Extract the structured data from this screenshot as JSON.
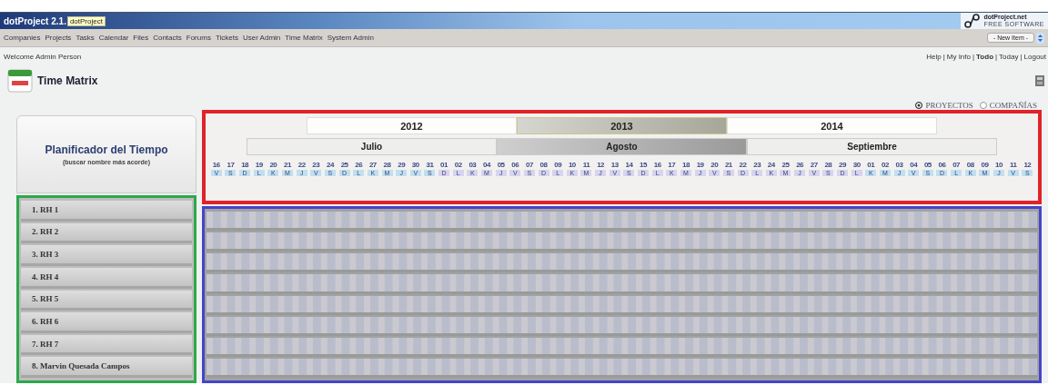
{
  "header": {
    "title": "dotProject 2.1.",
    "tooltip": "dotProject",
    "logo": {
      "name": "dotProject.net",
      "tagline": "FREE SOFTWARE"
    }
  },
  "menu": [
    "Companies",
    "Projects",
    "Tasks",
    "Calendar",
    "Files",
    "Contacts",
    "Forums",
    "Tickets",
    "User Admin",
    "Time Matrix",
    "System Admin"
  ],
  "new_item": "- New Item -",
  "welcome": "Welcome Admin Person",
  "link_separator": "|",
  "user_links": [
    {
      "label": "Help",
      "bold": false
    },
    {
      "label": "My Info",
      "bold": false
    },
    {
      "label": "Todo",
      "bold": true
    },
    {
      "label": "Today",
      "bold": false
    },
    {
      "label": "Logout",
      "bold": false
    }
  ],
  "page_title": "Time Matrix",
  "view_options": [
    {
      "label": "PROYECTOS",
      "selected": true
    },
    {
      "label": "COMPAÑÍAS",
      "selected": false
    }
  ],
  "planner": {
    "title": "Planificador del Tiempo",
    "subtitle": "(buscar nombre más acorde)"
  },
  "years": [
    {
      "label": "2012",
      "selected": false
    },
    {
      "label": "2013",
      "selected": true
    },
    {
      "label": "2014",
      "selected": false
    }
  ],
  "months": [
    {
      "label": "Julio",
      "selected": false,
      "days": [
        {
          "day": "16",
          "weekday": "V"
        },
        {
          "day": "17",
          "weekday": "S"
        },
        {
          "day": "18",
          "weekday": "D"
        },
        {
          "day": "19",
          "weekday": "L"
        },
        {
          "day": "20",
          "weekday": "K"
        },
        {
          "day": "21",
          "weekday": "M"
        },
        {
          "day": "22",
          "weekday": "J"
        },
        {
          "day": "23",
          "weekday": "V"
        },
        {
          "day": "24",
          "weekday": "S"
        },
        {
          "day": "25",
          "weekday": "D"
        },
        {
          "day": "26",
          "weekday": "L"
        },
        {
          "day": "27",
          "weekday": "K"
        },
        {
          "day": "28",
          "weekday": "M"
        },
        {
          "day": "29",
          "weekday": "J"
        },
        {
          "day": "30",
          "weekday": "V"
        },
        {
          "day": "31",
          "weekday": "S"
        }
      ]
    },
    {
      "label": "Agosto",
      "selected": true,
      "days": [
        {
          "day": "01",
          "weekday": "D"
        },
        {
          "day": "02",
          "weekday": "L"
        },
        {
          "day": "03",
          "weekday": "K"
        },
        {
          "day": "04",
          "weekday": "M"
        },
        {
          "day": "05",
          "weekday": "J"
        },
        {
          "day": "06",
          "weekday": "V"
        },
        {
          "day": "07",
          "weekday": "S"
        },
        {
          "day": "08",
          "weekday": "D"
        },
        {
          "day": "09",
          "weekday": "L"
        },
        {
          "day": "10",
          "weekday": "K"
        },
        {
          "day": "11",
          "weekday": "M"
        },
        {
          "day": "12",
          "weekday": "J"
        },
        {
          "day": "13",
          "weekday": "V"
        },
        {
          "day": "14",
          "weekday": "S"
        },
        {
          "day": "15",
          "weekday": "D"
        },
        {
          "day": "16",
          "weekday": "L"
        },
        {
          "day": "17",
          "weekday": "K"
        },
        {
          "day": "18",
          "weekday": "M"
        },
        {
          "day": "19",
          "weekday": "J"
        },
        {
          "day": "20",
          "weekday": "V"
        },
        {
          "day": "21",
          "weekday": "S"
        },
        {
          "day": "22",
          "weekday": "D"
        },
        {
          "day": "23",
          "weekday": "L"
        },
        {
          "day": "24",
          "weekday": "K"
        },
        {
          "day": "25",
          "weekday": "M"
        },
        {
          "day": "26",
          "weekday": "J"
        },
        {
          "day": "27",
          "weekday": "V"
        },
        {
          "day": "28",
          "weekday": "S"
        },
        {
          "day": "29",
          "weekday": "D"
        },
        {
          "day": "30",
          "weekday": "L"
        }
      ]
    },
    {
      "label": "Septiembre",
      "selected": false,
      "days": [
        {
          "day": "01",
          "weekday": "K"
        },
        {
          "day": "02",
          "weekday": "M"
        },
        {
          "day": "03",
          "weekday": "J"
        },
        {
          "day": "04",
          "weekday": "V"
        },
        {
          "day": "05",
          "weekday": "S"
        },
        {
          "day": "06",
          "weekday": "D"
        },
        {
          "day": "07",
          "weekday": "L"
        },
        {
          "day": "08",
          "weekday": "K"
        },
        {
          "day": "09",
          "weekday": "M"
        },
        {
          "day": "10",
          "weekday": "J"
        },
        {
          "day": "11",
          "weekday": "V"
        },
        {
          "day": "12",
          "weekday": "S"
        }
      ]
    }
  ],
  "resources": [
    "1. RH 1",
    "2. RH 2",
    "3. RH 3",
    "4. RH 4",
    "5. RH 5",
    "6. RH 6",
    "7. RH 7",
    "8. Marvin Quesada Campos"
  ]
}
